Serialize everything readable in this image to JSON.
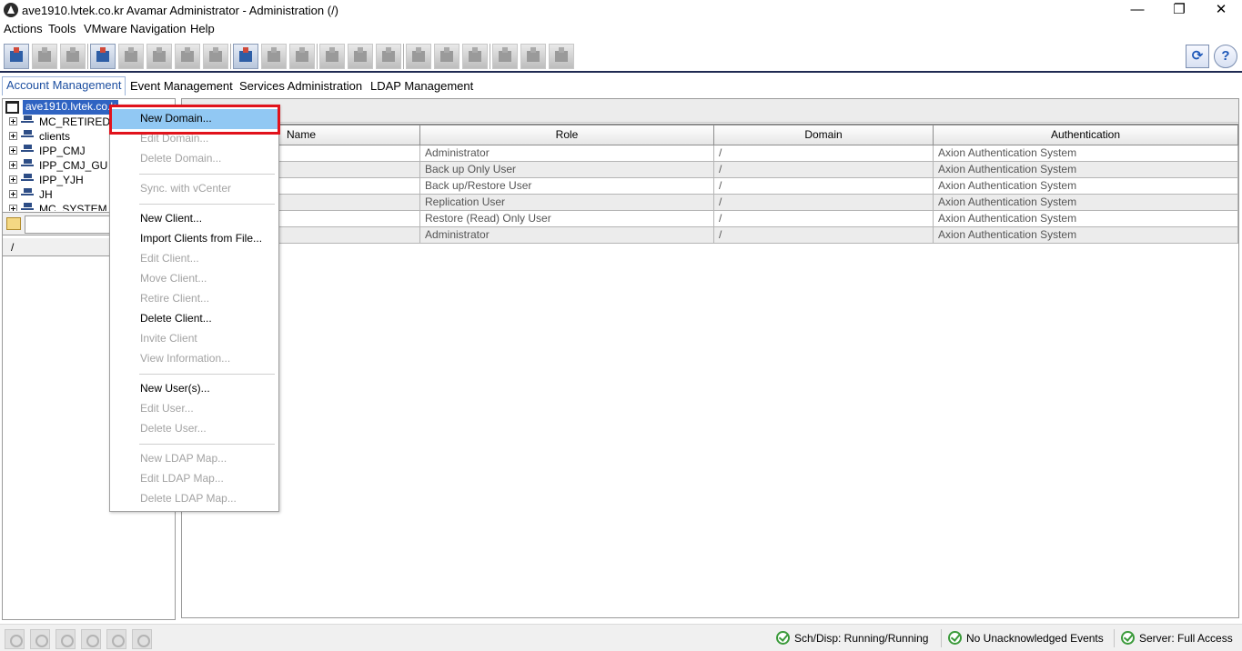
{
  "window": {
    "title": "ave1910.lvtek.co.kr Avamar Administrator - Administration (/)",
    "minimize": "—",
    "restore": "❐",
    "close": "✕"
  },
  "menubar": [
    "Actions",
    "Tools",
    "VMware",
    "Navigation",
    "Help"
  ],
  "toolbar": {
    "refresh_icon": "refresh-icon",
    "help_icon": "help-icon",
    "refresh_glyph": "⟳",
    "help_glyph": "?"
  },
  "tabs": [
    {
      "label": "Account Management",
      "selected": true
    },
    {
      "label": "Event Management",
      "selected": false
    },
    {
      "label": "Services Administration",
      "selected": false
    },
    {
      "label": "LDAP Management",
      "selected": false
    }
  ],
  "tree": {
    "root": "ave1910.lvtek.co.k",
    "items": [
      "MC_RETIRED",
      "clients",
      "IPP_CMJ",
      "IPP_CMJ_GU",
      "IPP_YJH",
      "JH",
      "MC_SYSTEM"
    ]
  },
  "left_list": {
    "column": "/"
  },
  "right_panel": {
    "subheader": "s",
    "columns": [
      "Name",
      "Role",
      "Domain",
      "Authentication"
    ],
    "rows": [
      {
        "name": "",
        "role": "Administrator",
        "domain": "/",
        "auth": "Axion Authentication System"
      },
      {
        "name": "",
        "role": "Back up Only User",
        "domain": "/",
        "auth": "Axion Authentication System"
      },
      {
        "name": "",
        "role": "Back up/Restore User",
        "domain": "/",
        "auth": "Axion Authentication System"
      },
      {
        "name": "",
        "role": "Replication User",
        "domain": "/",
        "auth": "Axion Authentication System"
      },
      {
        "name": "",
        "role": "Restore (Read) Only User",
        "domain": "/",
        "auth": "Axion Authentication System"
      },
      {
        "name": "",
        "role": "Administrator",
        "domain": "/",
        "auth": "Axion Authentication System"
      }
    ]
  },
  "context_menu": {
    "items": [
      {
        "label": "New Domain...",
        "enabled": true,
        "highlighted": true
      },
      {
        "label": "Edit Domain...",
        "enabled": false
      },
      {
        "label": "Delete Domain...",
        "enabled": false
      },
      {
        "separator": true
      },
      {
        "label": "Sync. with vCenter",
        "enabled": false
      },
      {
        "separator": true
      },
      {
        "label": "New Client...",
        "enabled": true
      },
      {
        "label": "Import Clients from File...",
        "enabled": true
      },
      {
        "label": "Edit Client...",
        "enabled": false
      },
      {
        "label": "Move Client...",
        "enabled": false
      },
      {
        "label": "Retire Client...",
        "enabled": false
      },
      {
        "label": "Delete Client...",
        "enabled": true
      },
      {
        "label": "Invite Client",
        "enabled": false
      },
      {
        "label": "View Information...",
        "enabled": false
      },
      {
        "separator": true
      },
      {
        "label": "New User(s)...",
        "enabled": true
      },
      {
        "label": "Edit User...",
        "enabled": false
      },
      {
        "label": "Delete User...",
        "enabled": false
      },
      {
        "separator": true
      },
      {
        "label": "New LDAP Map...",
        "enabled": false
      },
      {
        "label": "Edit LDAP Map...",
        "enabled": false
      },
      {
        "label": "Delete LDAP Map...",
        "enabled": false
      }
    ]
  },
  "statusbar": {
    "items": [
      {
        "icon": "check-icon",
        "text": "Sch/Disp: Running/Running"
      },
      {
        "icon": "check-icon",
        "text": "No Unacknowledged Events"
      },
      {
        "icon": "check-icon",
        "text": "Server: Full Access"
      }
    ]
  },
  "colors": {
    "selection": "#2f63c2",
    "menu_highlight": "#91c8f3",
    "callout_red": "#e1121b",
    "status_green": "#3a9a3a"
  }
}
